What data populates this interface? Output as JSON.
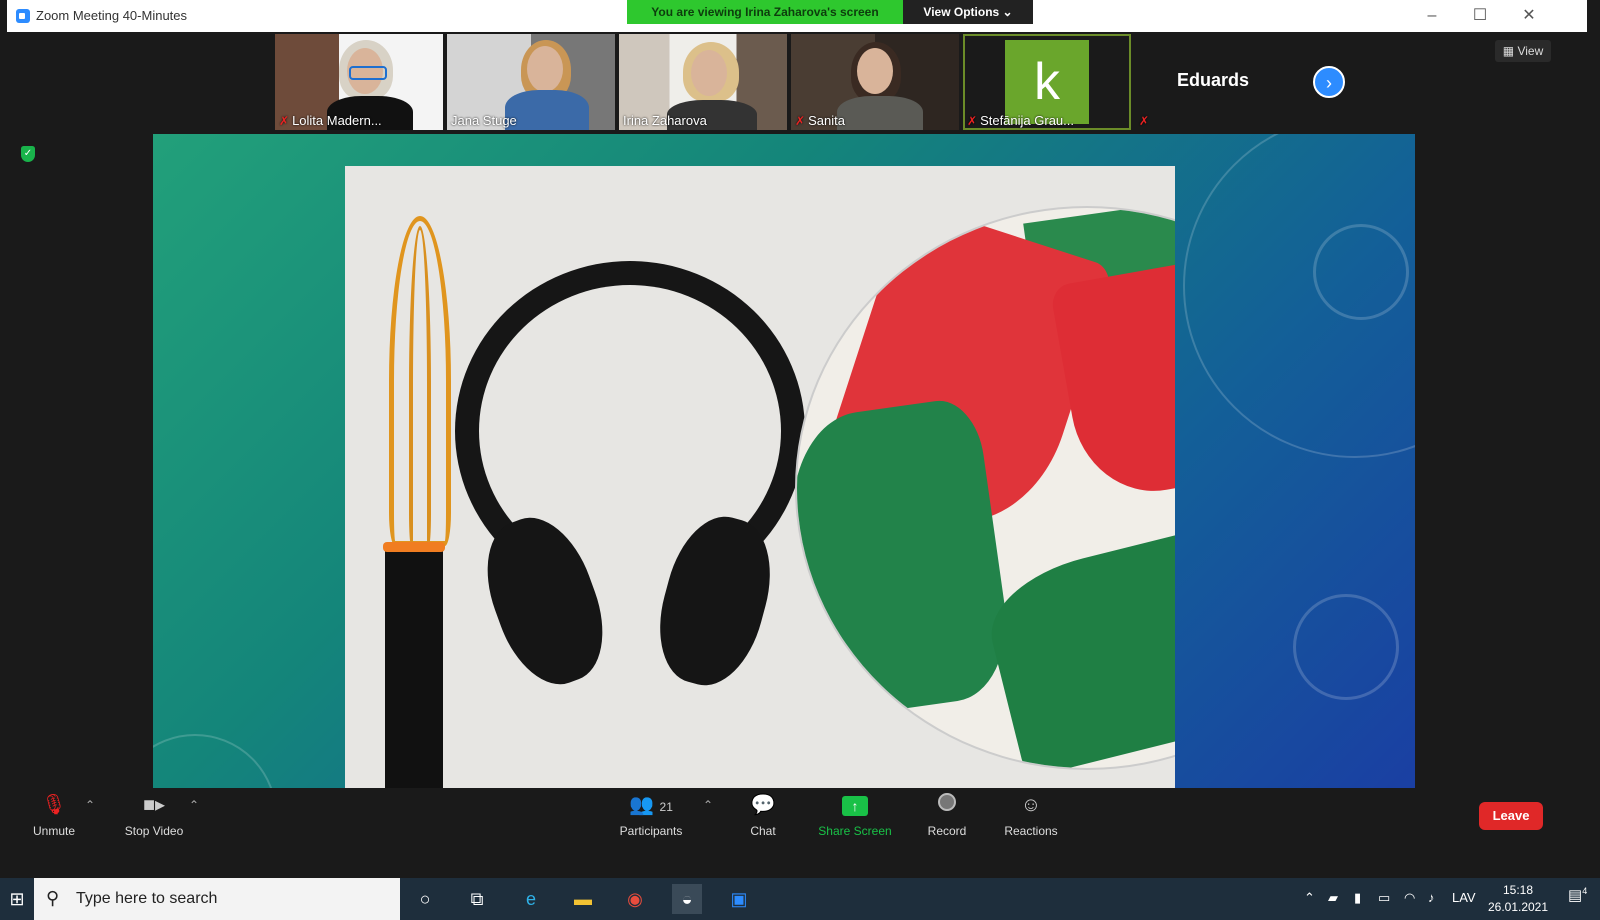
{
  "window": {
    "title": "Zoom Meeting 40-Minutes"
  },
  "banner": {
    "viewing": "You are viewing Irina Zaharova's screen",
    "view_options": "View Options ⌄"
  },
  "participants": [
    {
      "name": "Lolita Madern...",
      "muted": true
    },
    {
      "name": "Jana Stuge",
      "muted": false
    },
    {
      "name": "Irina Zaharova",
      "muted": false
    },
    {
      "name": "Sanita",
      "muted": true
    },
    {
      "name": "Stefānija Grau...",
      "muted": true,
      "avatar_letter": "k",
      "avatar_color": "#6aa62c"
    }
  ],
  "extra_participant": {
    "name": "Eduards",
    "muted": true
  },
  "view_button": "View",
  "toolbar": {
    "unmute": "Unmute",
    "stop_video": "Stop Video",
    "participants": "Participants",
    "participants_count": "21",
    "chat": "Chat",
    "share_screen": "Share Screen",
    "record": "Record",
    "reactions": "Reactions",
    "leave": "Leave"
  },
  "taskbar": {
    "search_placeholder": "Type here to search",
    "language": "LAV",
    "time": "15:18",
    "date": "26.01.2021",
    "notifications": "4"
  },
  "colors": {
    "zoom_blue": "#2d8cff",
    "share_green": "#19c147",
    "leave_red": "#e02828",
    "banner_green": "#2ec82e"
  }
}
